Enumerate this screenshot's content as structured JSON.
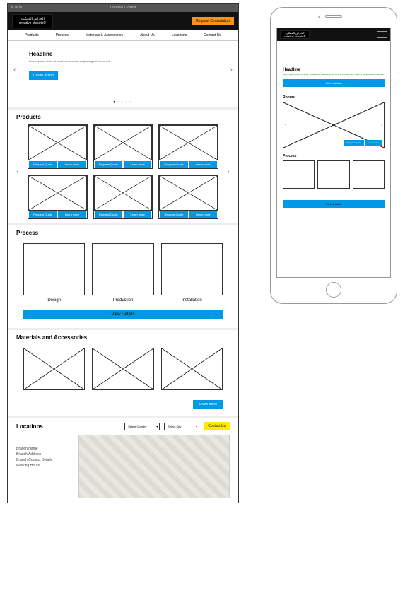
{
  "window_title": "Creative Closets",
  "logo": {
    "arabic": "الخزائن المبتكرة",
    "english": "creative closets®"
  },
  "header": {
    "cta": "Request Consultation"
  },
  "nav": [
    "Products",
    "Process",
    "Materials & Accessories",
    "About Us",
    "Locations",
    "Contact Us"
  ],
  "hero": {
    "headline": "Headline",
    "body": "Lorem ipsum dolor sit amet, consectetur adipiscing elit. Nunc vel…",
    "cta": "Call to action"
  },
  "products": {
    "title": "Products",
    "btn_quote": "Request Quote",
    "btn_learn": "Learn more"
  },
  "process": {
    "title": "Process",
    "steps": [
      "Design",
      "Production",
      "Installation"
    ],
    "btn": "View Details"
  },
  "materials": {
    "title": "Materials and Accessories",
    "btn": "Learn more"
  },
  "locations": {
    "title": "Locations",
    "select_country": "Select Country",
    "select_city": "Select City",
    "contact_btn": "Contact Us",
    "info": [
      "Branch Name",
      "Branch Address",
      "Branch Contact Details",
      "Working Hours"
    ]
  },
  "mobile": {
    "hero": {
      "headline": "Headline",
      "body": "Lorem ipsum dolor sit amet, consectetur adipiscing elit. Duis et ultricies sem. Nam ut semper lectus ultricies.",
      "cta": "Call to action"
    },
    "rooms": {
      "title": "Rooms",
      "btn_quote": "Request Quote",
      "btn_learn": "Learn more"
    },
    "process": {
      "title": "Process",
      "btn": "View Details"
    }
  }
}
